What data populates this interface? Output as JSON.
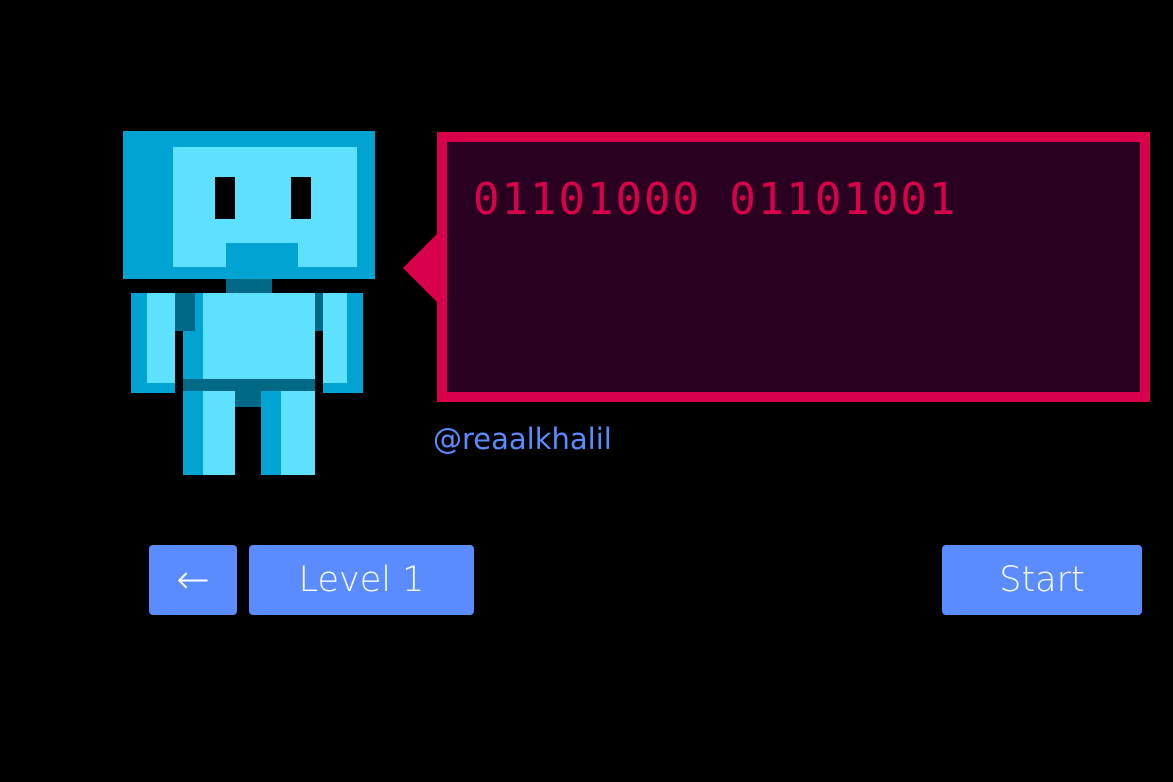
{
  "robot": {
    "icon": "robot-icon",
    "colors": {
      "head_dark": "#00a3d1",
      "head_light": "#5ee1ff",
      "eyes": "#000000",
      "shade": "#006a86"
    }
  },
  "speech_bubble": {
    "text": "01101000 01101001",
    "border_color": "#d8004b",
    "background_color": "#2a0020",
    "text_color": "#d8004b"
  },
  "author": {
    "handle": "@reaalkhalil",
    "color": "#5b8cff"
  },
  "controls": {
    "back_label": "←",
    "level_label": "Level 1",
    "start_label": "Start",
    "button_color": "#5b8cff",
    "button_text_color": "#ffffff"
  }
}
